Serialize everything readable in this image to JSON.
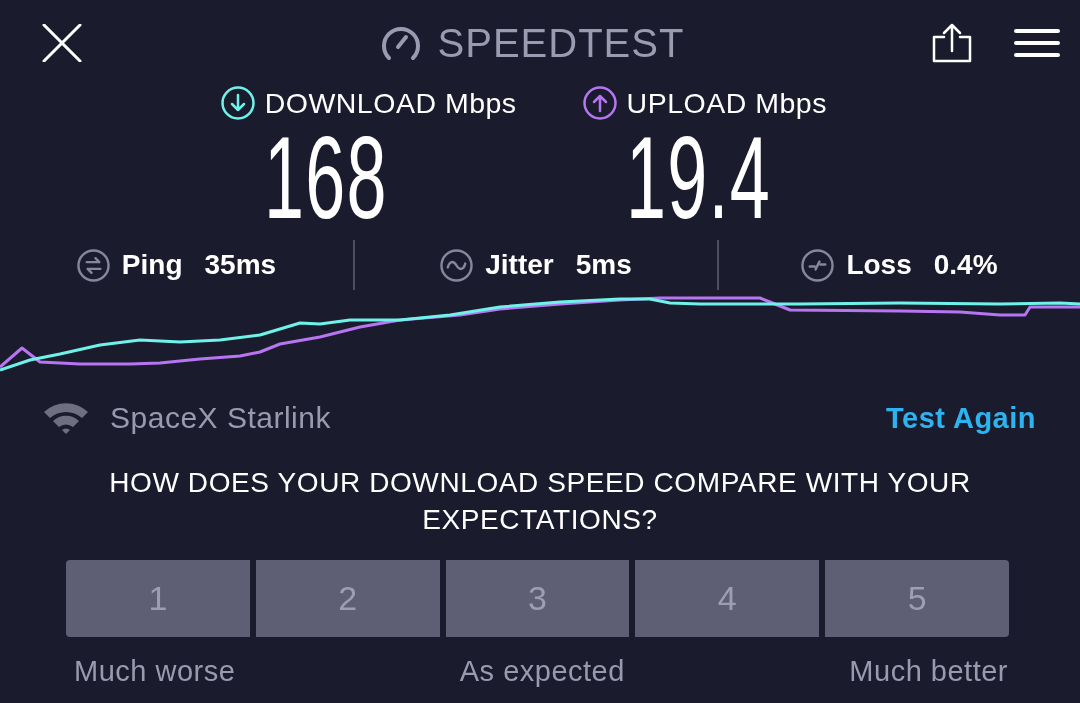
{
  "header": {
    "title": "SPEEDTEST"
  },
  "results": [
    {
      "kind": "download",
      "label": "DOWNLOAD Mbps",
      "value": "168",
      "color": "#6ff2e9"
    },
    {
      "kind": "upload",
      "label": "UPLOAD Mbps",
      "value": "19.4",
      "color": "#b875f2"
    }
  ],
  "metrics": [
    {
      "kind": "ping",
      "label": "Ping",
      "value": "35ms"
    },
    {
      "kind": "jitter",
      "label": "Jitter",
      "value": "5ms"
    },
    {
      "kind": "loss",
      "label": "Loss",
      "value": "0.4%"
    }
  ],
  "connection": {
    "provider": "SpaceX Starlink",
    "action": "Test Again"
  },
  "survey": {
    "question": "HOW DOES YOUR DOWNLOAD SPEED COMPARE WITH YOUR EXPECTATIONS?",
    "options": [
      {
        "label": "1",
        "selected": false
      },
      {
        "label": "2",
        "selected": false
      },
      {
        "label": "3",
        "selected": false
      },
      {
        "label": "4",
        "selected": false
      },
      {
        "label": "5",
        "selected": false
      }
    ],
    "scale_labels": [
      "Much worse",
      "As expected",
      "Much better"
    ]
  }
}
